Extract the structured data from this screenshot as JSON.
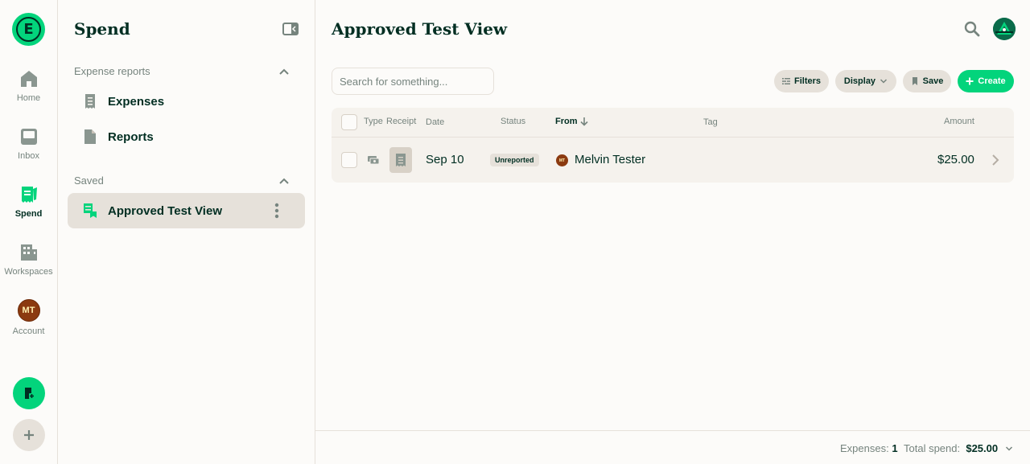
{
  "rail": {
    "items": [
      {
        "label": "Home"
      },
      {
        "label": "Inbox"
      },
      {
        "label": "Spend"
      },
      {
        "label": "Workspaces"
      },
      {
        "label": "Account",
        "avatar": "MT"
      }
    ]
  },
  "sidebar": {
    "title": "Spend",
    "sections": [
      {
        "label": "Expense reports",
        "items": [
          {
            "label": "Expenses"
          },
          {
            "label": "Reports"
          }
        ]
      },
      {
        "label": "Saved",
        "items": [
          {
            "label": "Approved Test View"
          }
        ]
      }
    ]
  },
  "main": {
    "title": "Approved Test View",
    "search_placeholder": "Search for something...",
    "buttons": {
      "filters": "Filters",
      "display": "Display",
      "save": "Save",
      "create": "Create"
    },
    "table": {
      "columns": {
        "type": "Type",
        "receipt": "Receipt",
        "date": "Date",
        "status": "Status",
        "from": "From",
        "tag": "Tag",
        "amount": "Amount"
      },
      "rows": [
        {
          "date": "Sep 10",
          "status": "Unreported",
          "from_initials": "MT",
          "from": "Melvin Tester",
          "tag": "",
          "amount": "$25.00"
        }
      ]
    },
    "footer": {
      "expenses_label": "Expenses:",
      "expenses_count": "1",
      "total_label": "Total spend:",
      "total_value": "$25.00"
    }
  },
  "colors": {
    "accent": "#03d47c",
    "text": "#002e22",
    "muted": "#76847e",
    "surface": "#f5f2ed",
    "border": "#e6e1da"
  }
}
